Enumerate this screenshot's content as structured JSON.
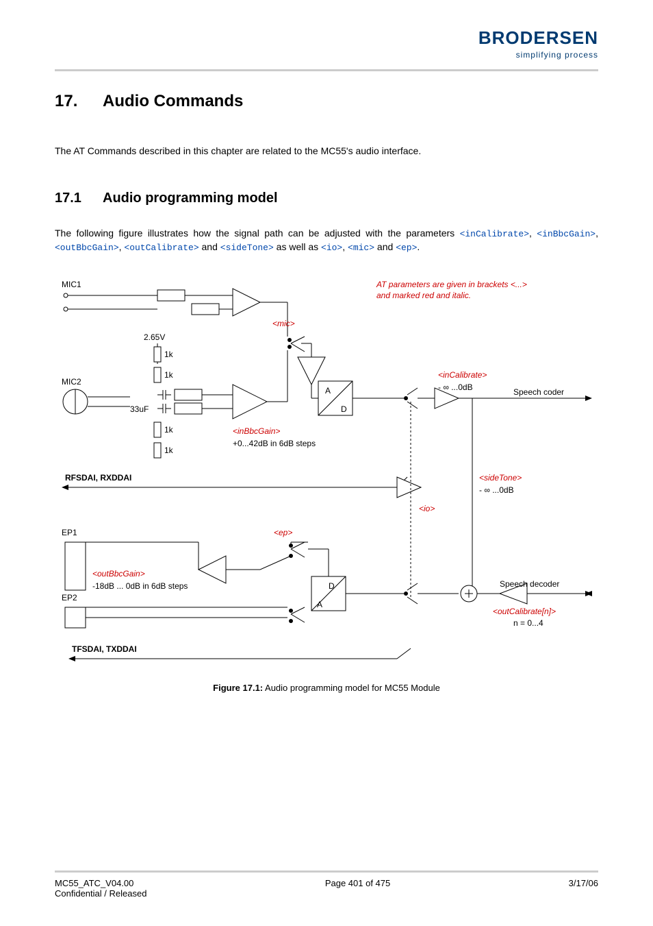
{
  "brand": {
    "name": "BRODERSEN",
    "tagline": "simplifying process"
  },
  "chapter": {
    "num": "17.",
    "title": "Audio Commands"
  },
  "intro": "The AT Commands described in this chapter are related to the MC55's audio interface.",
  "section": {
    "num": "17.1",
    "title": "Audio programming model"
  },
  "para": {
    "lead": "The following figure illustrates how the signal path can be adjusted with the parameters ",
    "p1": "<inCalibrate>",
    "c1": ", ",
    "p2": "<inBbcGain>",
    "c2": ", ",
    "p3": "<outBbcGain>",
    "c3": ", ",
    "p4": "<outCalibrate>",
    "mid": " and ",
    "p5": "<sideTone>",
    "mid2": " as well as ",
    "p6": "<io>",
    "c4": ", ",
    "p7": "<mic>",
    "mid3": " and ",
    "p8": "<ep>",
    "tail": "."
  },
  "diagram": {
    "note1": "AT parameters are given in brackets <...>",
    "note2": "and marked red and italic.",
    "mic1": "MIC1",
    "mic2": "MIC2",
    "v": "2.65V",
    "r1k": "1k",
    "c33": "33uF",
    "mic_param": "<mic>",
    "inbbc": "<inBbcGain>",
    "inbbc_range": "+0...42dB in 6dB steps",
    "A": "A",
    "D": "D",
    "incal": "<inCalibrate>",
    "incal_range": "- ∞ ...0dB",
    "speech_coder": "Speech coder",
    "rfsdai": "RFSDAI, RXDDAI",
    "sidetone": "<sideTone>",
    "sidetone_range": "- ∞ ...0dB",
    "io": "<io>",
    "ep1": "EP1",
    "ep2": "EP2",
    "ep_param": "<ep>",
    "outbbc": "<outBbcGain>",
    "outbbc_range": "-18dB ... 0dB in 6dB steps",
    "speech_decoder": "Speech decoder",
    "outcal": "<outCalibrate[n]>",
    "outcal_range": "n = 0...4",
    "tfsdai": "TFSDAI, TXDDAI"
  },
  "caption": {
    "label": "Figure 17.1:",
    "text": " Audio programming model for MC55 Module"
  },
  "footer": {
    "doc": "MC55_ATC_V04.00",
    "conf": "Confidential / Released",
    "page": "Page 401 of 475",
    "date": "3/17/06"
  }
}
